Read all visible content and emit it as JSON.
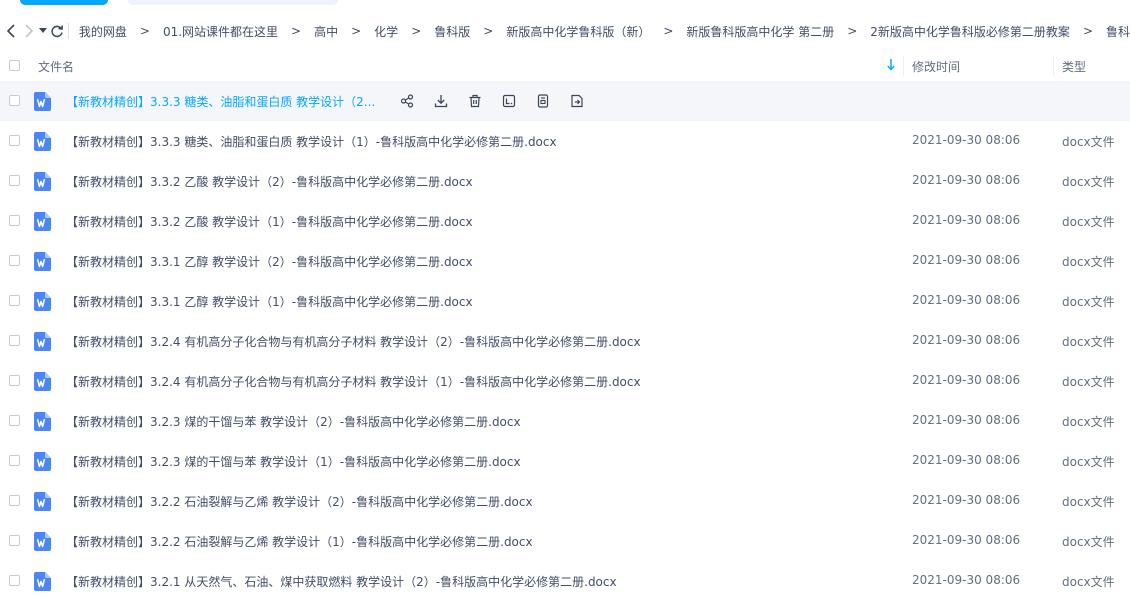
{
  "nav": {
    "breadcrumbs": [
      "我的网盘",
      "01.网站课件都在这里",
      "高中",
      "化学",
      "鲁科版",
      "新版高中化学鲁科版（新）",
      "新版鲁科版高中化学 第二册",
      "2新版高中化学鲁科版必修第二册教案",
      "鲁科"
    ],
    "separator": ">"
  },
  "header": {
    "name": "文件名",
    "mtime": "修改时间",
    "type": "类型"
  },
  "files": [
    {
      "name": "【新教材精创】3.3.3 糖类、油脂和蛋白质 教学设计（2...",
      "mtime": "",
      "type": "",
      "hovered": true
    },
    {
      "name": "【新教材精创】3.3.3 糖类、油脂和蛋白质 教学设计（1）-鲁科版高中化学必修第二册.docx",
      "mtime": "2021-09-30 08:06",
      "type": "docx文件"
    },
    {
      "name": "【新教材精创】3.3.2 乙酸 教学设计（2）-鲁科版高中化学必修第二册.docx",
      "mtime": "2021-09-30 08:06",
      "type": "docx文件"
    },
    {
      "name": "【新教材精创】3.3.2 乙酸 教学设计（1）-鲁科版高中化学必修第二册.docx",
      "mtime": "2021-09-30 08:06",
      "type": "docx文件"
    },
    {
      "name": "【新教材精创】3.3.1 乙醇 教学设计（2）-鲁科版高中化学必修第二册.docx",
      "mtime": "2021-09-30 08:06",
      "type": "docx文件"
    },
    {
      "name": "【新教材精创】3.3.1 乙醇 教学设计（1）-鲁科版高中化学必修第二册.docx",
      "mtime": "2021-09-30 08:06",
      "type": "docx文件"
    },
    {
      "name": "【新教材精创】3.2.4 有机高分子化合物与有机高分子材料 教学设计（2）-鲁科版高中化学必修第二册.docx",
      "mtime": "2021-09-30 08:06",
      "type": "docx文件"
    },
    {
      "name": "【新教材精创】3.2.4 有机高分子化合物与有机高分子材料 教学设计（1）-鲁科版高中化学必修第二册.docx",
      "mtime": "2021-09-30 08:06",
      "type": "docx文件"
    },
    {
      "name": "【新教材精创】3.2.3 煤的干馏与苯 教学设计（2）-鲁科版高中化学必修第二册.docx",
      "mtime": "2021-09-30 08:06",
      "type": "docx文件"
    },
    {
      "name": "【新教材精创】3.2.3 煤的干馏与苯 教学设计（1）-鲁科版高中化学必修第二册.docx",
      "mtime": "2021-09-30 08:06",
      "type": "docx文件"
    },
    {
      "name": "【新教材精创】3.2.2 石油裂解与乙烯 教学设计（2）-鲁科版高中化学必修第二册.docx",
      "mtime": "2021-09-30 08:06",
      "type": "docx文件"
    },
    {
      "name": "【新教材精创】3.2.2 石油裂解与乙烯 教学设计（1）-鲁科版高中化学必修第二册.docx",
      "mtime": "2021-09-30 08:06",
      "type": "docx文件"
    },
    {
      "name": "【新教材精创】3.2.1 从天然气、石油、煤中获取燃料 教学设计（2）-鲁科版高中化学必修第二册.docx",
      "mtime": "2021-09-30 08:06",
      "type": "docx文件"
    }
  ],
  "row_actions": [
    "share-icon",
    "download-icon",
    "delete-icon",
    "text-icon",
    "copy-icon",
    "move-icon"
  ],
  "colors": {
    "accent": "#06a7ff",
    "text": "#424e67",
    "hover_bg": "#f5f6fa",
    "word_icon": "#4a86f5"
  }
}
